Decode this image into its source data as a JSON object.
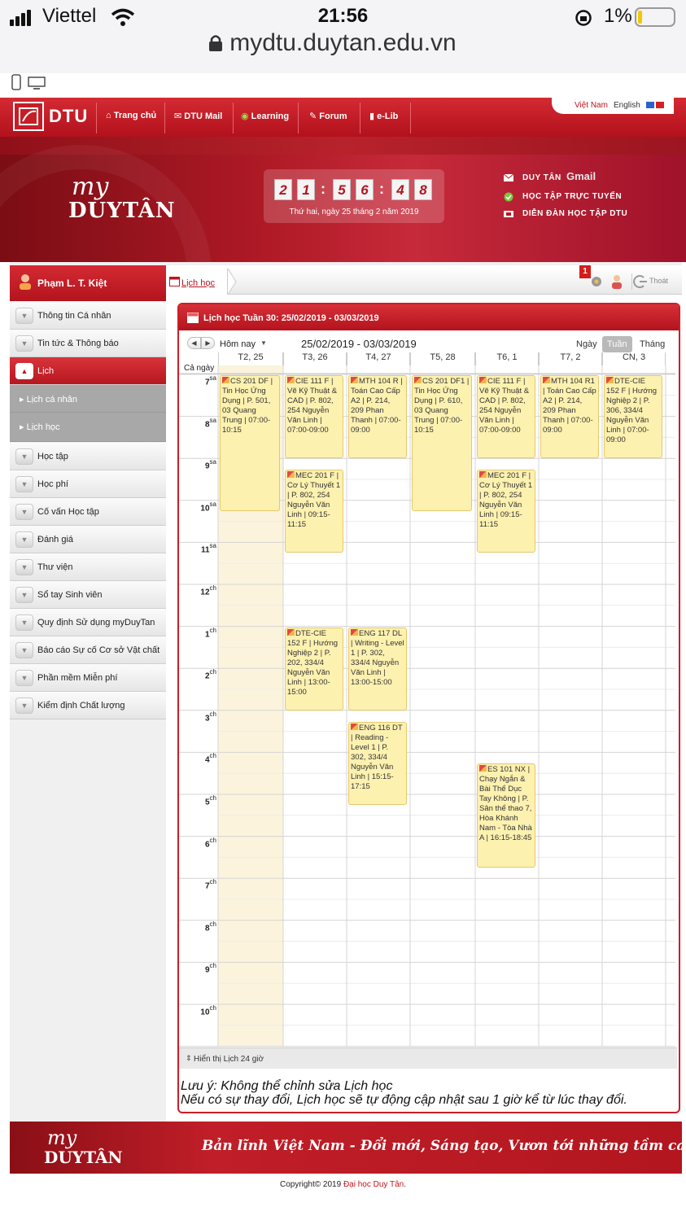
{
  "status_bar": {
    "carrier": "Viettel",
    "time": "21:56",
    "battery": "1%",
    "url": "mydtu.duytan.edu.vn"
  },
  "header": {
    "logo_text": "DTU",
    "nav": [
      "Trang chủ",
      "DTU Mail",
      "Learning",
      "Forum",
      "e-Lib"
    ],
    "lang": {
      "vn": "Việt Nam",
      "en": "English"
    }
  },
  "banner": {
    "brand_my": "my",
    "brand_name": "DUYTÂN",
    "clock_digits": [
      "2",
      "1",
      "5",
      "6",
      "4",
      "8"
    ],
    "date_text": "Thứ hai, ngày 25 tháng 2 năm 2019",
    "links": [
      "DUY TÂN",
      "HỌC TẬP TRỰC TUYẾN",
      "DIỄN ĐÀN HỌC TẬP DTU"
    ],
    "gmail_label": "Gmail"
  },
  "sidebar": {
    "user_name": "Phạm L. T. Kiệt",
    "items": [
      "Thông tin Cá nhân",
      "Tin tức & Thông báo",
      "Lịch",
      "Học tập",
      "Học phí",
      "Cố vấn Học tập",
      "Đánh giá",
      "Thư viện",
      "Sổ tay Sinh viên",
      "Quy định Sử dụng myDuyTan",
      "Báo cáo Sự cố Cơ sở Vật chất",
      "Phần mềm Miễn phí",
      "Kiểm định Chất lượng"
    ],
    "sub_items": [
      "Lịch cá nhân",
      "Lịch học"
    ]
  },
  "tabbar": {
    "tab": "Lịch học",
    "logout": "Thoát",
    "notification_count": "1"
  },
  "calendar": {
    "title": "Lịch học Tuần 30: 25/02/2019 - 03/03/2019",
    "today_btn": "Hôm nay",
    "range": "25/02/2019 - 03/03/2019",
    "views": [
      "Ngày",
      "Tuần",
      "Tháng"
    ],
    "active_view": "Tuần",
    "all_day": "Cả ngày",
    "days": [
      "T2, 25",
      "T3, 26",
      "T4, 27",
      "T5, 28",
      "T6, 1",
      "T7, 2",
      "CN, 3"
    ],
    "hours": [
      {
        "h": "7",
        "s": "sa"
      },
      {
        "h": "8",
        "s": "sa"
      },
      {
        "h": "9",
        "s": "sa"
      },
      {
        "h": "10",
        "s": "sa"
      },
      {
        "h": "11",
        "s": "sa"
      },
      {
        "h": "12",
        "s": "ch"
      },
      {
        "h": "1",
        "s": "ch"
      },
      {
        "h": "2",
        "s": "ch"
      },
      {
        "h": "3",
        "s": "ch"
      },
      {
        "h": "4",
        "s": "ch"
      },
      {
        "h": "5",
        "s": "ch"
      },
      {
        "h": "6",
        "s": "ch"
      },
      {
        "h": "7",
        "s": "ch"
      },
      {
        "h": "8",
        "s": "ch"
      },
      {
        "h": "9",
        "s": "ch"
      },
      {
        "h": "10",
        "s": "ch"
      }
    ],
    "events": [
      {
        "day": 0,
        "start": "07:00",
        "end": "10:15",
        "text": "CS 201 DF | Tin Học Ứng Dụng | P. 501, 03 Quang Trung | 07:00-10:15"
      },
      {
        "day": 1,
        "start": "07:00",
        "end": "09:00",
        "text": "CIE 111 F | Vẽ Kỹ Thuật & CAD | P. 802, 254 Nguyễn Văn Linh | 07:00-09:00"
      },
      {
        "day": 2,
        "start": "07:00",
        "end": "09:00",
        "text": "MTH 104 R | Toán Cao Cấp A2 | P. 214, 209 Phan Thanh | 07:00-09:00"
      },
      {
        "day": 3,
        "start": "07:00",
        "end": "10:15",
        "text": "CS 201 DF1 | Tin Học Ứng Dụng | P. 610, 03 Quang Trung | 07:00-10:15"
      },
      {
        "day": 4,
        "start": "07:00",
        "end": "09:00",
        "text": "CIE 111 F | Vẽ Kỹ Thuật & CAD | P. 802, 254 Nguyễn Văn Linh | 07:00-09:00"
      },
      {
        "day": 5,
        "start": "07:00",
        "end": "09:00",
        "text": "MTH 104 R1 | Toán Cao Cấp A2 | P. 214, 209 Phan Thanh | 07:00-09:00"
      },
      {
        "day": 6,
        "start": "07:00",
        "end": "09:00",
        "text": "DTE-CIE 152 F | Hướng Nghiệp 2 | P. 306, 334/4 Nguyễn Văn Linh | 07:00-09:00"
      },
      {
        "day": 1,
        "start": "09:15",
        "end": "11:15",
        "text": "MEC 201 F | Cơ Lý Thuyết 1 | P. 802, 254 Nguyễn Văn Linh | 09:15-11:15"
      },
      {
        "day": 4,
        "start": "09:15",
        "end": "11:15",
        "text": "MEC 201 F | Cơ Lý Thuyết 1 | P. 802, 254 Nguyễn Văn Linh | 09:15-11:15"
      },
      {
        "day": 1,
        "start": "13:00",
        "end": "15:00",
        "text": "DTE-CIE 152 F | Hướng Nghiệp 2 | P. 202, 334/4 Nguyễn Văn Linh | 13:00-15:00"
      },
      {
        "day": 2,
        "start": "13:00",
        "end": "15:00",
        "text": "ENG 117 DL | Writing - Level 1 | P. 302, 334/4 Nguyễn Văn Linh | 13:00-15:00"
      },
      {
        "day": 2,
        "start": "15:15",
        "end": "17:15",
        "text": "ENG 116 DT | Reading - Level 1 | P. 302, 334/4 Nguyễn Văn Linh | 15:15-17:15"
      },
      {
        "day": 4,
        "start": "16:15",
        "end": "18:45",
        "text": "ES 101 NX | Chạy Ngắn & Bài Thể Dục Tay Không | P. Sân thể thao 7, Hòa Khánh Nam - Tòa Nhà A | 16:15-18:45"
      }
    ],
    "show24": "Hiển thị Lịch 24 giờ"
  },
  "note": {
    "line1": "Lưu ý: Không thể chỉnh sửa Lịch học",
    "line2": "Nếu có sự thay đổi, Lịch học sẽ tự động cập nhật sau 1 giờ kể từ lúc thay đổi."
  },
  "footer": {
    "brand_my": "my",
    "brand_name": "DUYTÂN",
    "slogan": "Bản lĩnh Việt Nam - Đổi mới, Sáng tạo, Vươn tới những tầm cao!",
    "copyright_prefix": "Copyright© 2019 ",
    "copyright_org": "Đại học Duy Tân",
    "copyright_suffix": "."
  },
  "colors": {
    "brand_red": "#c0141c",
    "event_bg": "#fdf1b0",
    "today_col": "#fbf3dc"
  }
}
